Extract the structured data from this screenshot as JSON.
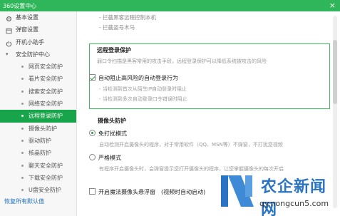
{
  "window": {
    "title": "360设置中心",
    "close_glyph": "×"
  },
  "sidebar": {
    "items": [
      {
        "label": "基本设置",
        "kind": "top",
        "icon": "gear-icon"
      },
      {
        "label": "弹窗设置",
        "kind": "top",
        "icon": "window-icon"
      },
      {
        "label": "开机小助手",
        "kind": "top",
        "icon": "power-icon"
      },
      {
        "label": "安全防护中心",
        "kind": "group",
        "icon": "caret-icon"
      },
      {
        "label": "网页安全防护",
        "kind": "sub"
      },
      {
        "label": "看片安全防护",
        "kind": "sub"
      },
      {
        "label": "搜索安全防护",
        "kind": "sub"
      },
      {
        "label": "网络安全防护",
        "kind": "sub"
      },
      {
        "label": "远程登录防护",
        "kind": "sub",
        "active": true
      },
      {
        "label": "摄像头防护",
        "kind": "sub"
      },
      {
        "label": "驱动防护",
        "kind": "sub"
      },
      {
        "label": "核晶防护",
        "kind": "sub"
      },
      {
        "label": "聊天安全防护",
        "kind": "sub"
      },
      {
        "label": "下载安全防护",
        "kind": "sub"
      },
      {
        "label": "U盘安全防护",
        "kind": "sub"
      }
    ],
    "restore_label": "恢复所有默认值"
  },
  "main": {
    "pre_lines": [
      "- 拦截黑客远程控制本机",
      "- 拦截盗号木马"
    ],
    "remote": {
      "title": "远程登录保护",
      "desc": "弱口令扫描是黑客常用的攻击手段，远程登录保护可以降低系统被攻击的风险",
      "checkbox_label": "自动阻止高风险的自动登录行为",
      "checked": true,
      "sub_lines": [
        "- 当检测到首次从陌生IP自动登录时阻止",
        "- 当检测到多次自动登录口令错误时阻止"
      ]
    },
    "camera": {
      "title": "摄像头防护",
      "options": [
        {
          "label": "免打扰模式",
          "selected": true,
          "desc": "自动检测开启摄像头的程序，对于常用软件（QQ、MSN等）不弹窗，不打扰您视频"
        },
        {
          "label": "严格模式",
          "selected": false,
          "desc": "有程序开启摄像头时，会弹窗提示您打开摄像头的程序，让您掌握摄像头的每次开启"
        }
      ],
      "floating_label": "开启魔法摄像头悬浮窗　(视频时自动启动)"
    }
  },
  "watermark": {
    "text": "农企新闻网",
    "url": "qy.nongcun5.com"
  },
  "colors": {
    "titlebar": "#2fb65a",
    "accent": "#18a44a",
    "highlight_border": "#3dbb5e",
    "watermark": "#2a74c4"
  }
}
